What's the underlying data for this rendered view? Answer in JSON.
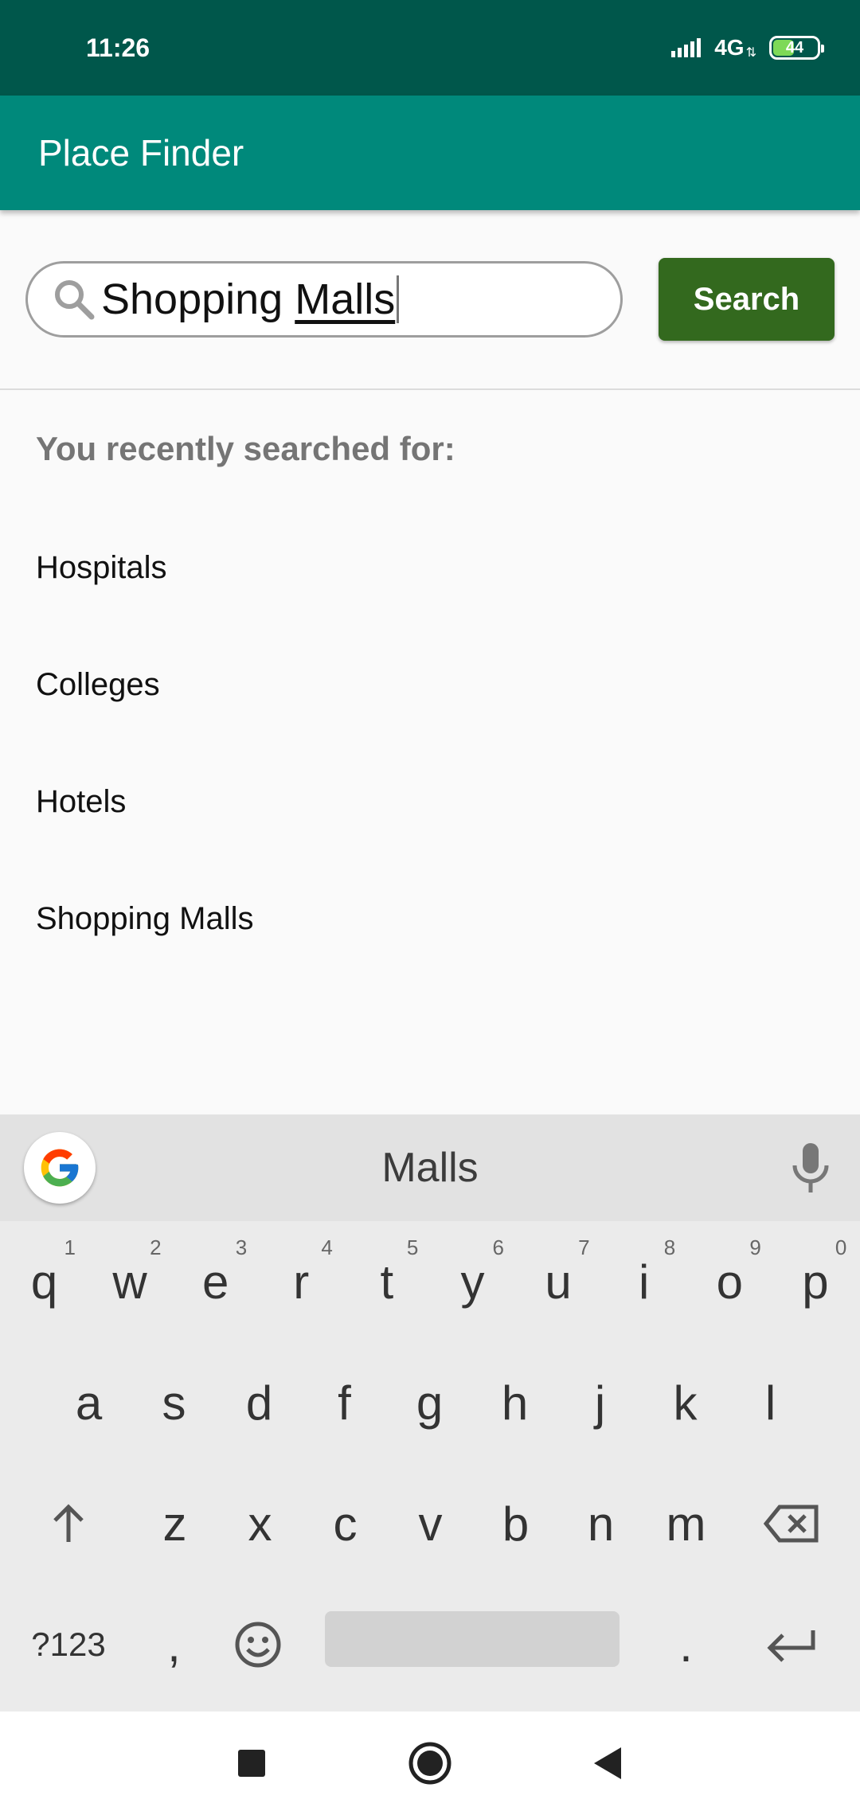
{
  "status_bar": {
    "time": "11:26",
    "network": "4G",
    "battery": "44",
    "battery_level": 0.44
  },
  "app_bar": {
    "title": "Place Finder",
    "color": "#00897b"
  },
  "search": {
    "value_prefix": "Shopping ",
    "value_composing": "Malls",
    "button_label": "Search",
    "button_color": "#33691e"
  },
  "recent": {
    "header": "You recently searched for:",
    "items": [
      "Hospitals",
      "Colleges",
      "Hotels",
      "Shopping Malls"
    ]
  },
  "keyboard": {
    "suggestion": "Malls",
    "row1": [
      {
        "key": "q",
        "hint": "1"
      },
      {
        "key": "w",
        "hint": "2"
      },
      {
        "key": "e",
        "hint": "3"
      },
      {
        "key": "r",
        "hint": "4"
      },
      {
        "key": "t",
        "hint": "5"
      },
      {
        "key": "y",
        "hint": "6"
      },
      {
        "key": "u",
        "hint": "7"
      },
      {
        "key": "i",
        "hint": "8"
      },
      {
        "key": "o",
        "hint": "9"
      },
      {
        "key": "p",
        "hint": "0"
      }
    ],
    "row2": [
      "a",
      "s",
      "d",
      "f",
      "g",
      "h",
      "j",
      "k",
      "l"
    ],
    "row3": [
      "z",
      "x",
      "c",
      "v",
      "b",
      "n",
      "m"
    ],
    "row4": {
      "symbols": "?123",
      "comma": ",",
      "period": "."
    }
  }
}
